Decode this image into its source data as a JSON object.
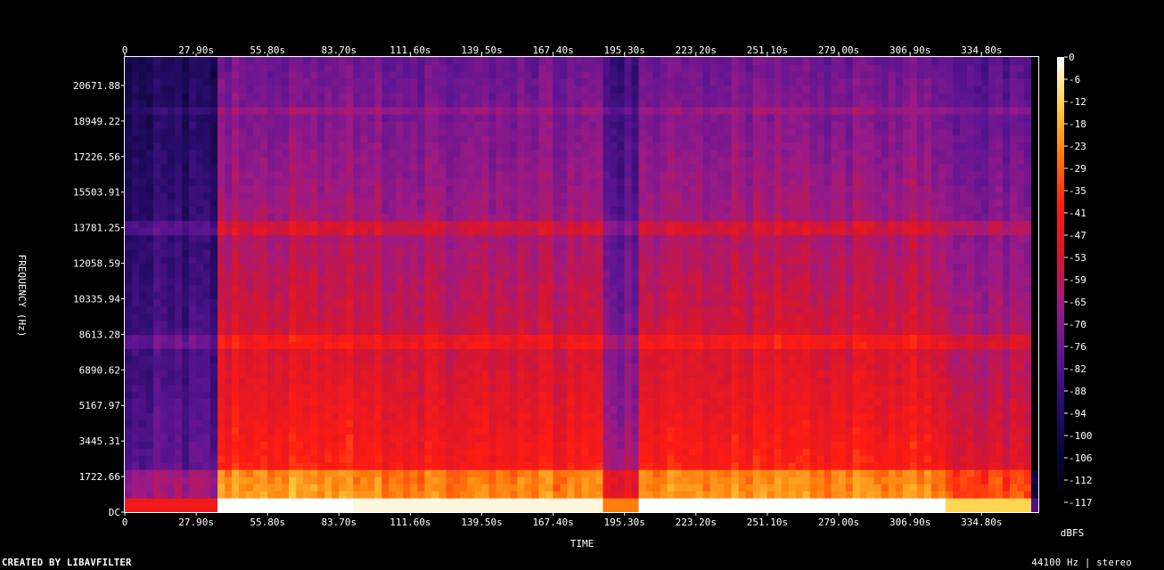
{
  "chart_data": {
    "type": "heatmap",
    "xlabel": "TIME",
    "ylabel": "FREQUENCY (Hz)",
    "x_ticks": [
      "0",
      "27.90s",
      "55.80s",
      "83.70s",
      "111.60s",
      "139.50s",
      "167.40s",
      "195.30s",
      "223.20s",
      "251.10s",
      "279.00s",
      "306.90s",
      "334.80s"
    ],
    "x_tick_values": [
      0,
      27.9,
      55.8,
      83.7,
      111.6,
      139.5,
      167.4,
      195.3,
      223.2,
      251.1,
      279.0,
      306.9,
      334.8
    ],
    "xlim": [
      0,
      357
    ],
    "y_ticks": [
      "DC",
      "1722.66",
      "3445.31",
      "5167.97",
      "6890.62",
      "8613.28",
      "10335.94",
      "12058.59",
      "13781.25",
      "15503.91",
      "17226.56",
      "18949.22",
      "20671.88"
    ],
    "y_tick_values": [
      0,
      1722.66,
      3445.31,
      5167.97,
      6890.62,
      8613.28,
      10335.94,
      12058.59,
      13781.25,
      15503.91,
      17226.56,
      18949.22,
      20671.88
    ],
    "ylim": [
      0,
      22050
    ],
    "colorbar": {
      "label": "dBFS",
      "ticks": [
        "0",
        "-6",
        "-12",
        "-18",
        "-23",
        "-29",
        "-35",
        "-41",
        "-47",
        "-53",
        "-59",
        "-65",
        "-70",
        "-76",
        "-82",
        "-88",
        "-94",
        "-100",
        "-106",
        "-112",
        "-117"
      ],
      "range": [
        -117,
        0
      ],
      "colors": [
        "#000000",
        "#0a0636",
        "#2a0c6e",
        "#5e1592",
        "#9b1a86",
        "#d6162e",
        "#ff1c12",
        "#ff7a0c",
        "#ffd040",
        "#ffffff"
      ]
    },
    "segments": [
      {
        "t_start": 0,
        "t_end": 36,
        "level": 0.35
      },
      {
        "t_start": 36,
        "t_end": 88,
        "level": 0.74
      },
      {
        "t_start": 88,
        "t_end": 188,
        "level": 0.7
      },
      {
        "t_start": 188,
        "t_end": 200,
        "level": 0.5
      },
      {
        "t_start": 200,
        "t_end": 320,
        "level": 0.72
      },
      {
        "t_start": 320,
        "t_end": 355,
        "level": 0.62
      }
    ]
  },
  "footer": {
    "left": "CREATED BY LIBAVFILTER",
    "right": "44100 Hz | stereo"
  }
}
